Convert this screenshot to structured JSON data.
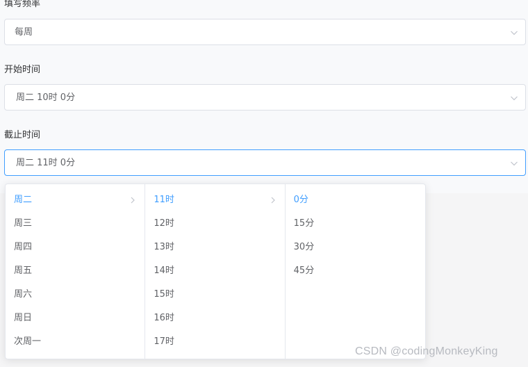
{
  "form": {
    "frequency": {
      "label": "填写频率",
      "value": "每周"
    },
    "start_time": {
      "label": "开始时间",
      "value": "周二 10时 0分"
    },
    "end_time": {
      "label": "截止时间",
      "value": "周二 11时 0分"
    }
  },
  "cascader": {
    "days": [
      "周二",
      "周三",
      "周四",
      "周五",
      "周六",
      "周日",
      "次周一"
    ],
    "hours": [
      "11时",
      "12时",
      "13时",
      "14时",
      "15时",
      "16时",
      "17时"
    ],
    "minutes": [
      "0分",
      "15分",
      "30分",
      "45分"
    ],
    "selected": {
      "day": "周二",
      "hour": "11时",
      "minute": "0分"
    }
  },
  "watermark": "CSDN @codingMonkeyKing",
  "colors": {
    "accent": "#409eff",
    "text": "#606266",
    "border": "#dcdfe6"
  },
  "icons": {
    "select_arrow": "chevron-down-icon",
    "submenu_arrow": "chevron-right-icon"
  }
}
